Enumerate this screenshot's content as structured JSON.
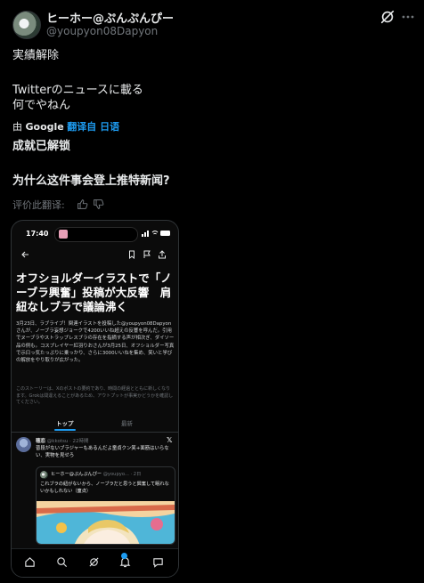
{
  "author": {
    "display_name": "ヒーホー@ぷんぷんぴー",
    "handle": "@youpyon08Dapyon"
  },
  "tweet": {
    "lines": [
      "実績解除",
      "",
      "Twitterのニュースに載る",
      "何でやねん"
    ]
  },
  "translation": {
    "prefix": "由",
    "provider": "Google",
    "link_label": "翻译自 日语",
    "lines": [
      "成就已解锁",
      "",
      "为什么这件事会登上推特新闻?"
    ]
  },
  "rate": {
    "label": "评价此翻译:"
  },
  "icons": {
    "grok": "grok-icon",
    "more": "more-icon",
    "thumbs_up": "thumbs-up-icon",
    "thumbs_down": "thumbs-down-icon"
  },
  "phone": {
    "status_time": "17:40",
    "headline": "オフショルダーイラストで「ノーブラ興奮」投稿が大反響　肩紐なしブラで議論沸く",
    "body": "3月23日、ラブライブ！関連イラストを投稿した@youpyon08Dapyonさんが、ノーブラ妄想ジョークで4200いいね超えの反響を呼んだ。引用でヌーブラやストラップレスブラの存在を指摘する声が相次ぎ、ダイソー品の例も。コスプレイヤー紅羽りおさんが3月25日、オフショルダー写真で示曰っ気たっぷりに乗っかり、さらに3000いいねを集め、笑いと学びの解放をやり取りが広がった。",
    "disclaimer": "このストーリーは、Xのポストの要約であり、時間の経過とともに新しくなります。Grokは間違えることがあるため、アウトプットが事実かどうかを確認してください。",
    "tabs": [
      "トップ",
      "最新"
    ],
    "post": {
      "user": "穂恋",
      "meta": "@kkotsu · 22時間",
      "text": "普段がないブラジャーもあるんだよ童貞クン笑+面筋はいらない、実物を見せろ"
    },
    "quote": {
      "user": "ヒーホー@ぷんぷんぴー",
      "meta": "@youpyo... · 2日",
      "text": "これブラの紐がないから、ノーブラだと思うと興奮して眠れないかもしれない（童貞）"
    }
  }
}
